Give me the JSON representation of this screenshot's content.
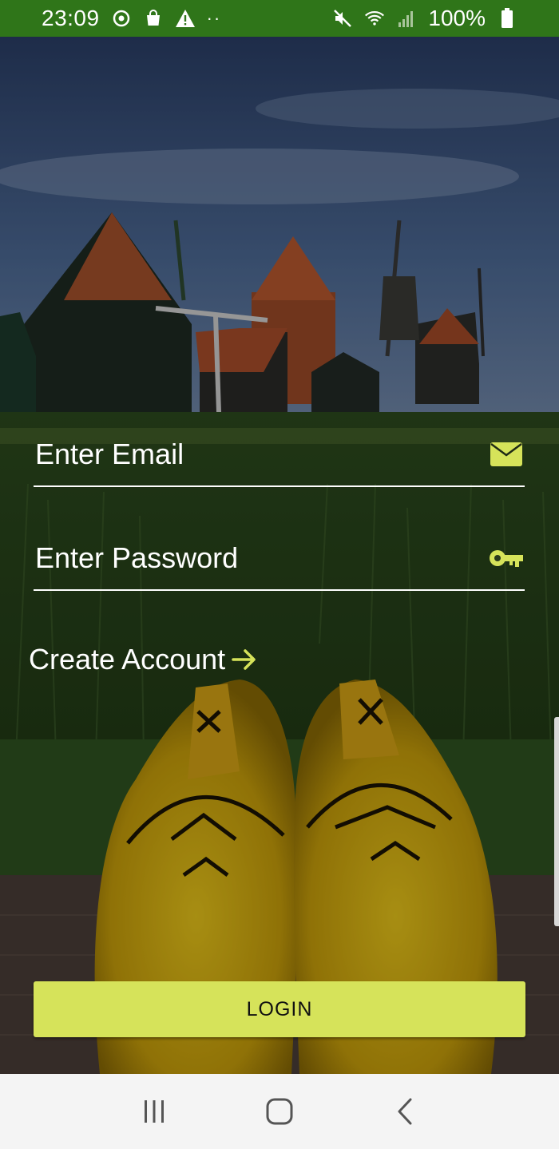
{
  "status_bar": {
    "time": "23:09",
    "left_icons": [
      "sync-icon",
      "shopping-bag-icon",
      "warning-icon",
      "more-dots-icon"
    ],
    "right_icons": [
      "mute-icon",
      "wifi-icon",
      "signal-icon",
      "battery-icon"
    ],
    "battery": "100%"
  },
  "form": {
    "email": {
      "placeholder": "Enter Email",
      "value": "",
      "icon": "mail-icon"
    },
    "password": {
      "placeholder": "Enter Password",
      "value": "",
      "icon": "key-icon"
    },
    "create_account_label": "Create Account",
    "create_account_icon": "arrow-right-icon",
    "login_label": "LOGIN"
  },
  "colors": {
    "status_bar": "#2f7519",
    "accent": "#d6e35a",
    "text": "#ffffff"
  },
  "nav_bar": {
    "buttons": [
      "recent-apps-icon",
      "home-icon",
      "back-icon"
    ]
  }
}
